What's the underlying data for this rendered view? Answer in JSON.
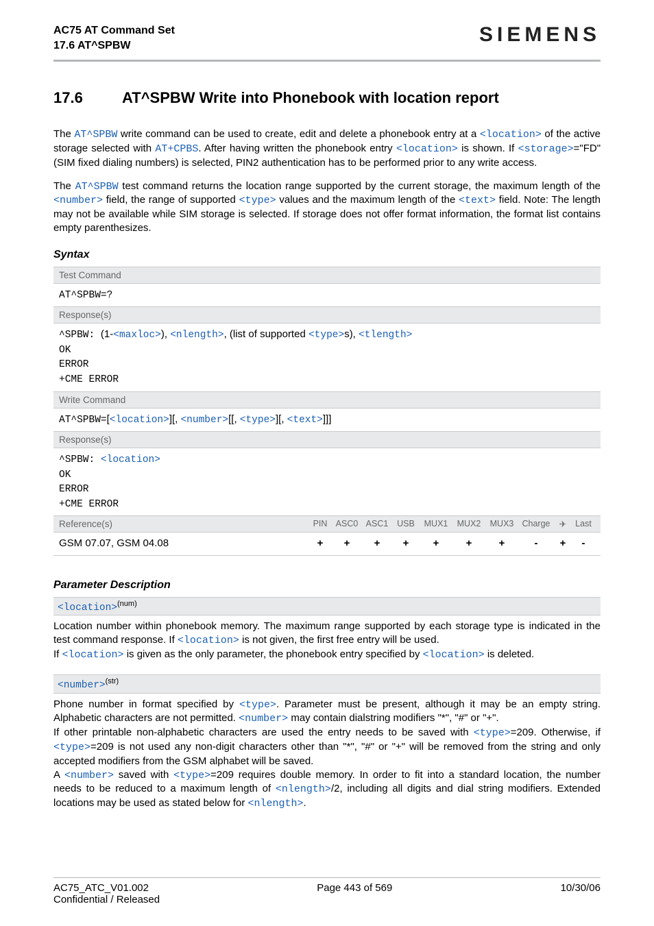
{
  "header": {
    "title_line1": "AC75 AT Command Set",
    "title_line2": "17.6 AT^SPBW",
    "logo": "SIEMENS"
  },
  "section": {
    "number": "17.6",
    "title": "AT^SPBW   Write into Phonebook with location report"
  },
  "intro": {
    "p1_a": "The ",
    "p1_cmd": "AT^SPBW",
    "p1_b": " write command can be used to create, edit and delete a phonebook entry at a ",
    "p1_loc": "<location>",
    "p1_c": " of the active storage selected with ",
    "p1_cpbs": "AT+CPBS",
    "p1_d": ". After having written the phonebook entry ",
    "p1_loc2": "<location>",
    "p1_e": " is shown. If ",
    "p1_stor": "<storage>",
    "p1_f": "=\"FD\" (SIM fixed dialing numbers) is selected, PIN2 authentication has to be performed prior to any write access.",
    "p2_a": "The ",
    "p2_cmd": "AT^SPBW",
    "p2_b": " test command returns the location range supported by the current storage, the maximum length of the ",
    "p2_num": "<number>",
    "p2_c": " field, the range of supported ",
    "p2_type": "<type>",
    "p2_d": " values and the maximum length of the ",
    "p2_text": "<text>",
    "p2_e": " field. Note: The length may not be available while SIM storage is selected. If storage does not offer format information, the format list contains empty parenthesizes."
  },
  "syntax": {
    "heading": "Syntax",
    "test_label": "Test Command",
    "test_cmd": "AT^SPBW=?",
    "resp_label": "Response(s)",
    "test_resp_prefix": "^SPBW: ",
    "test_resp_a": "(1-",
    "test_resp_maxloc": "<maxloc>",
    "test_resp_b": "), ",
    "test_resp_nlen": "<nlength>",
    "test_resp_c": ", (list of supported ",
    "test_resp_type": "<type>",
    "test_resp_d": "s), ",
    "test_resp_tlen": "<tlength>",
    "ok": "OK",
    "error": "ERROR",
    "cme": "+CME ERROR",
    "write_label": "Write Command",
    "write_prefix": "AT^SPBW=",
    "write_loc": "<location>",
    "write_a": "][, ",
    "write_num": "<number>",
    "write_b": "[[, ",
    "write_type": "<type>",
    "write_c": "][, ",
    "write_text": "<text>",
    "write_d": "]]]",
    "write_lbracket": "[",
    "write_resp_prefix": "^SPBW: ",
    "write_resp_loc": "<location>",
    "ref_label": "Reference(s)",
    "ref_text": "GSM 07.07, GSM 04.08",
    "cols": {
      "pin": "PIN",
      "asc0": "ASC0",
      "asc1": "ASC1",
      "usb": "USB",
      "mux1": "MUX1",
      "mux2": "MUX2",
      "mux3": "MUX3",
      "charge": "Charge",
      "air": "✈",
      "last": "Last"
    },
    "vals": {
      "pin": "+",
      "asc0": "+",
      "asc1": "+",
      "usb": "+",
      "mux1": "+",
      "mux2": "+",
      "mux3": "+",
      "charge": "-",
      "air": "+",
      "last": "-"
    }
  },
  "params": {
    "heading": "Parameter Description",
    "location": {
      "tag": "<location>",
      "sup": "(num)",
      "d1": "Location number within phonebook memory. The maximum range supported by each storage type is indicated in the test command response. If ",
      "d1_loc": "<location>",
      "d1b": " is not given, the first free entry will be used.",
      "d2a": "If ",
      "d2_loc": "<location>",
      "d2b": " is given as the only parameter, the phonebook entry specified by ",
      "d2_loc2": "<location>",
      "d2c": " is deleted."
    },
    "number": {
      "tag": "<number>",
      "sup": "(str)",
      "d1a": "Phone number in format specified by ",
      "d1_type": "<type>",
      "d1b": ". Parameter must be present, although it may be an empty string. Alphabetic characters are not permitted. ",
      "d1_num": "<number>",
      "d1c": " may contain dialstring modifiers \"*\", \"#\" or \"+\".",
      "d2a": "If other printable non-alphabetic characters are used the entry needs to be saved with ",
      "d2_type": "<type>",
      "d2b": "=209. Otherwise, if ",
      "d2_type2": "<type>",
      "d2c": "=209 is not used any non-digit characters other than \"*\", \"#\" or \"+\" will be removed from the string and only accepted modifiers from the GSM alphabet will be saved.",
      "d3a": "A ",
      "d3_num": "<number>",
      "d3b": " saved with ",
      "d3_type": "<type>",
      "d3c": "=209 requires double memory. In order to fit into a standard location, the number needs to be reduced to a maximum length of ",
      "d3_nlen": "<nlength>",
      "d3d": "/2, including all digits and dial string modifiers. Extended locations may be used as stated below for ",
      "d3_nlen2": "<nlength>",
      "d3e": "."
    }
  },
  "footer": {
    "left": "AC75_ATC_V01.002",
    "center": "Page 443 of 569",
    "right": "10/30/06",
    "conf": "Confidential / Released"
  }
}
